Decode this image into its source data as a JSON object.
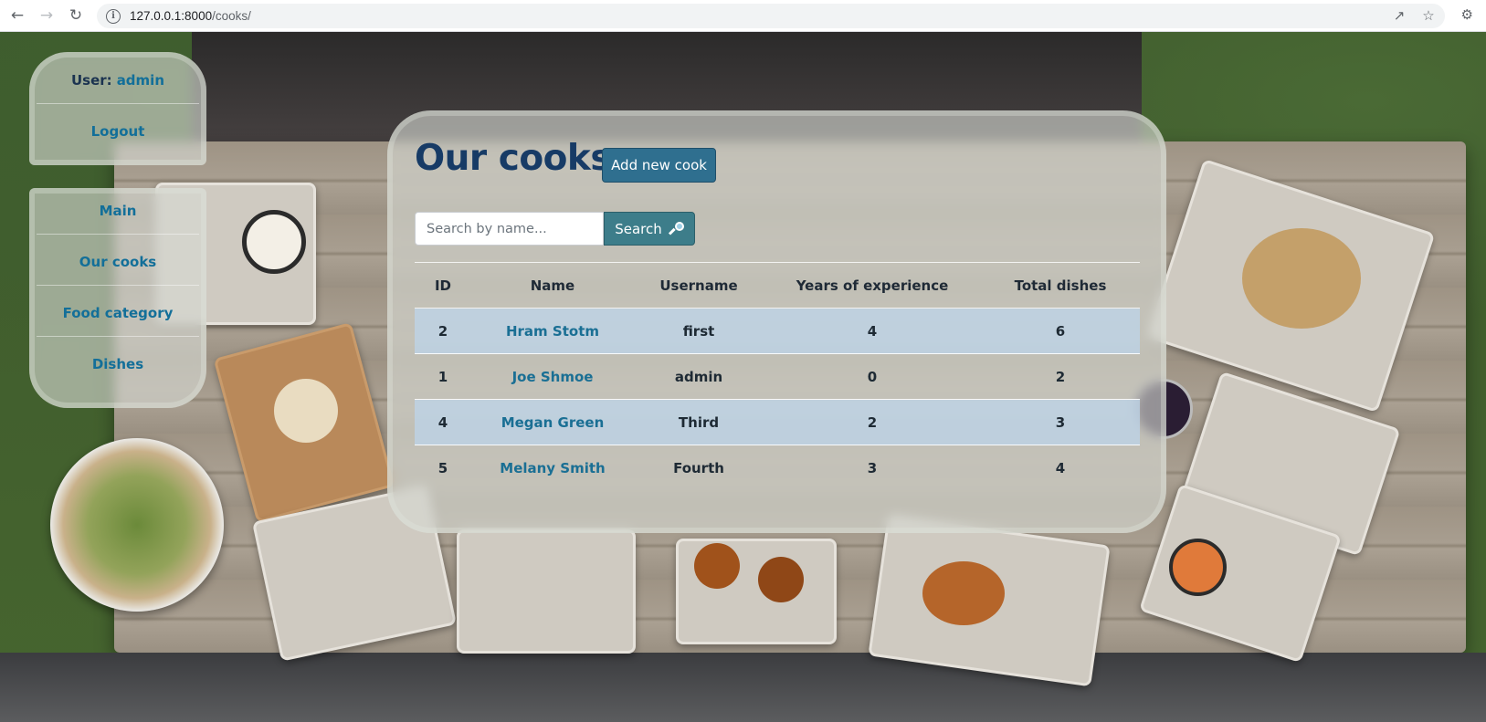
{
  "browser": {
    "url_host": "127.0.0.1:8000",
    "url_path": "/cooks/",
    "back_icon": "arrow-left-icon",
    "forward_icon": "arrow-right-icon",
    "reload_icon": "reload-icon",
    "info_icon": "info-icon",
    "share_icon": "share-icon",
    "bookmark_icon": "star-icon",
    "extensions_icon": "puzzle-icon"
  },
  "user_panel": {
    "user_label": "User:",
    "user_name": "admin",
    "logout_label": "Logout"
  },
  "nav": {
    "items": [
      {
        "label": "Main"
      },
      {
        "label": "Our cooks"
      },
      {
        "label": "Food category"
      },
      {
        "label": "Dishes"
      }
    ]
  },
  "main": {
    "title": "Our cooks:",
    "add_button_label": "Add new cook",
    "search": {
      "placeholder": "Search by name...",
      "value": "",
      "button_label": "Search",
      "button_icon": "magnifier-icon"
    },
    "table": {
      "headers": [
        "ID",
        "Name",
        "Username",
        "Years of experience",
        "Total dishes"
      ],
      "rows": [
        {
          "id": "2",
          "name": "Hram Stotm",
          "username": "first",
          "years": "4",
          "dishes": "6"
        },
        {
          "id": "1",
          "name": "Joe Shmoe",
          "username": "admin",
          "years": "0",
          "dishes": "2"
        },
        {
          "id": "4",
          "name": "Megan Green",
          "username": "Third",
          "years": "2",
          "dishes": "3"
        },
        {
          "id": "5",
          "name": "Melany Smith",
          "username": "Fourth",
          "years": "3",
          "dishes": "4"
        }
      ]
    }
  },
  "colors": {
    "title": "#173b66",
    "link": "#136f99",
    "add_button": "#2f6f8f",
    "search_button": "#3d7d8a",
    "row_stripe": "#bed4e8"
  }
}
